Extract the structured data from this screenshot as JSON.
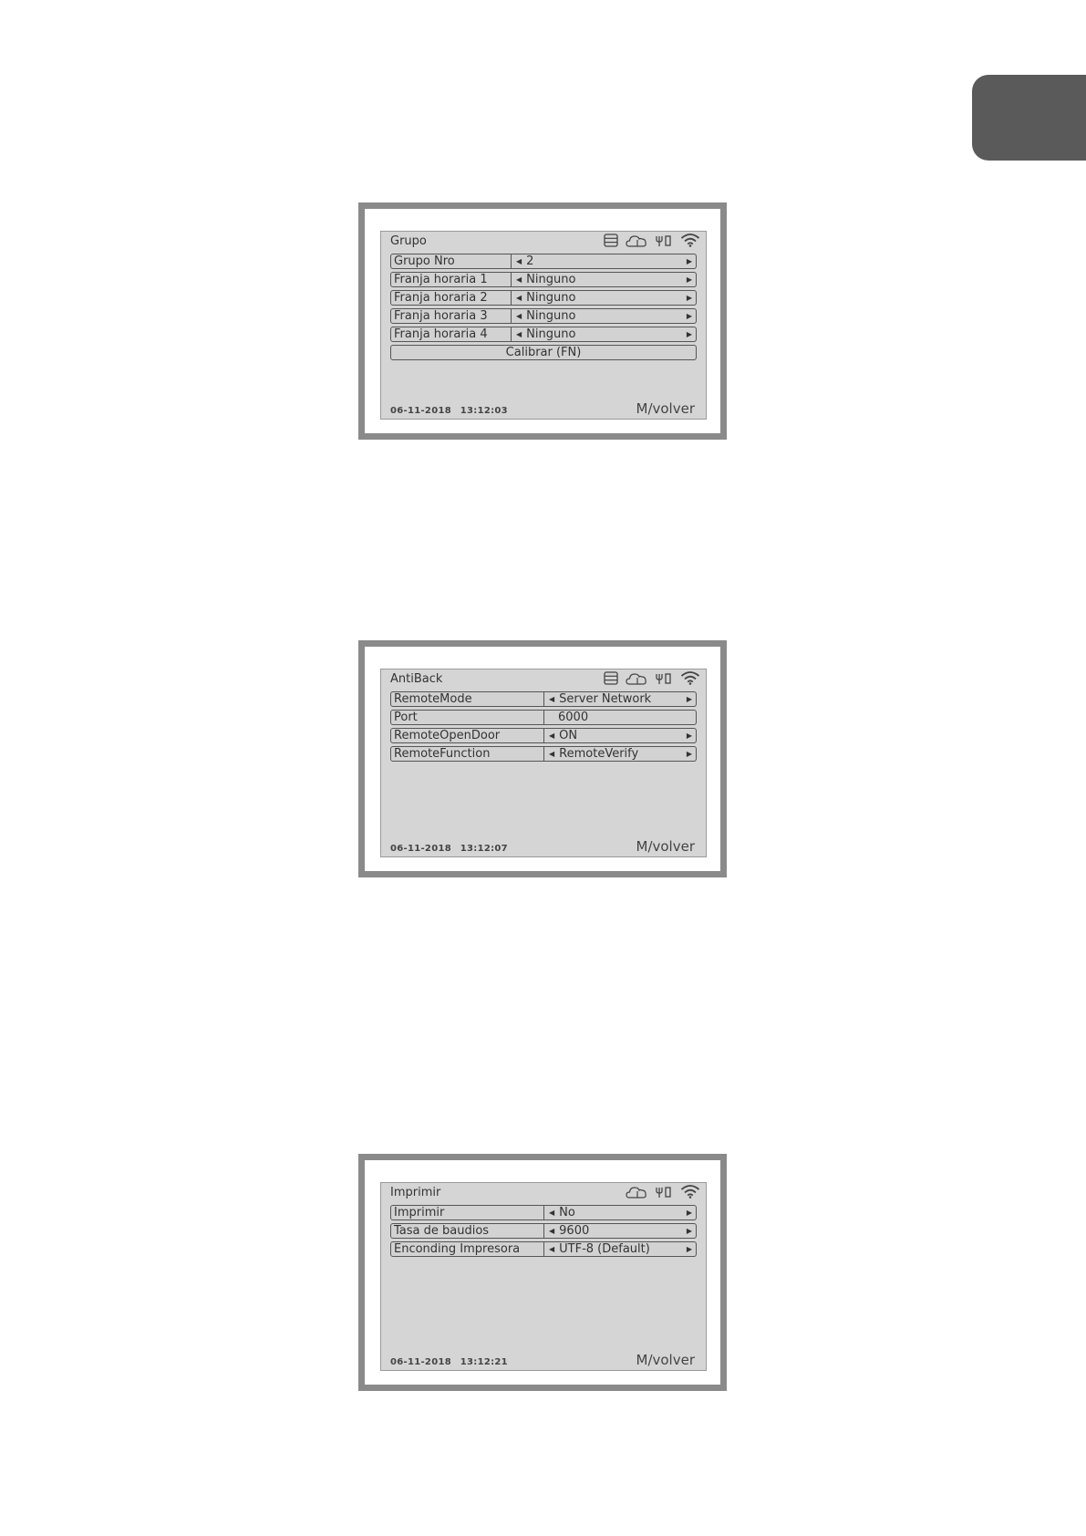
{
  "screens": [
    {
      "title": "Grupo",
      "rows": [
        {
          "label": "Grupo Nro",
          "value": "2"
        },
        {
          "label": "Franja horaria 1",
          "value": "Ninguno"
        },
        {
          "label": "Franja horaria 2",
          "value": "Ninguno"
        },
        {
          "label": "Franja horaria 3",
          "value": "Ninguno"
        },
        {
          "label": "Franja horaria 4",
          "value": "Ninguno"
        }
      ],
      "action": "Calibrar (FN)",
      "date": "06-11-2018",
      "time": "13:12:03",
      "brand": "M/volver"
    },
    {
      "title": "AntiBack",
      "rows": [
        {
          "label": "RemoteMode",
          "value": "Server Network"
        },
        {
          "label": "Port",
          "value": "6000"
        },
        {
          "label": "RemoteOpenDoor",
          "value": "ON"
        },
        {
          "label": "RemoteFunction",
          "value": "RemoteVerify"
        }
      ],
      "date": "06-11-2018",
      "time": "13:12:07",
      "brand": "M/volver"
    },
    {
      "title": "Imprimir",
      "rows": [
        {
          "label": "Imprimir",
          "value": "No"
        },
        {
          "label": "Tasa de baudios",
          "value": "9600"
        },
        {
          "label": "Enconding Impresora",
          "value": "UTF-8 (Default)"
        }
      ],
      "date": "06-11-2018",
      "time": "13:12:21",
      "brand": "M/volver"
    }
  ],
  "icons": {
    "storage": "storage-icon",
    "cloud": "cloud-icon",
    "usb": "usb-icon",
    "wifi": "wifi-icon"
  },
  "colors": {
    "frame": "#8a8a8a",
    "screen_bg": "#d5d5d5",
    "side_tab": "#5a5a5a"
  }
}
